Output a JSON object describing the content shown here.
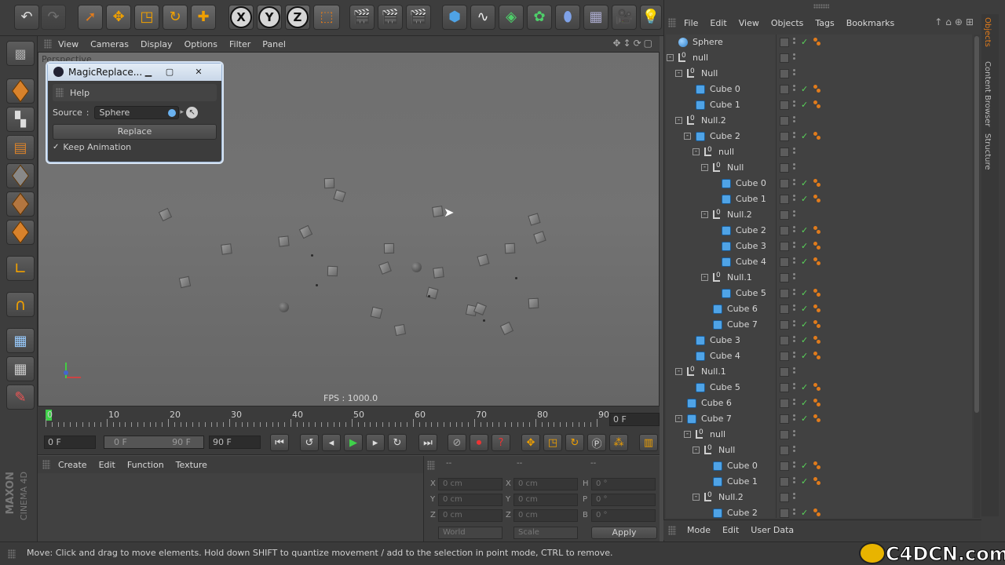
{
  "toolbar": {
    "axis_x": "X",
    "axis_y": "Y",
    "axis_z": "Z",
    "icons": [
      "undo-icon",
      "redo-icon",
      "select-icon",
      "move-icon",
      "scale-icon",
      "rotate-icon",
      "add-icon",
      "x-axis",
      "y-axis",
      "z-axis",
      "coord-system-icon",
      "render-view-icon",
      "render-pv-icon",
      "render-settings-icon",
      "cube-primitive-icon",
      "spline-icon",
      "nurbs-icon",
      "array-icon",
      "deformer-icon",
      "floor-icon",
      "camera-icon",
      "light-icon"
    ]
  },
  "viewport": {
    "menu": [
      "View",
      "Cameras",
      "Display",
      "Options",
      "Filter",
      "Panel"
    ],
    "label": "Perspective",
    "fps": "FPS : 1000.0"
  },
  "dialog": {
    "title": "MagicReplace...",
    "help": "Help",
    "source_label": "Source",
    "source_sep": ":",
    "source_value": "Sphere",
    "replace": "Replace",
    "keep_animation": "Keep Animation"
  },
  "timeline": {
    "ticks": [
      "0",
      "10",
      "20",
      "30",
      "40",
      "50",
      "60",
      "70",
      "80",
      "90"
    ],
    "current_frame": "0 F",
    "start": "0 F",
    "range_start": "0 F",
    "range_end": "90 F",
    "end": "90 F"
  },
  "material": {
    "menu": [
      "Create",
      "Edit",
      "Function",
      "Texture"
    ]
  },
  "coords": {
    "header": [
      "--",
      "--",
      "--"
    ],
    "rows": [
      {
        "a": "X",
        "av": "0 cm",
        "b": "X",
        "bv": "0 cm",
        "c": "H",
        "cv": "0 °"
      },
      {
        "a": "Y",
        "av": "0 cm",
        "b": "Y",
        "bv": "0 cm",
        "c": "P",
        "cv": "0 °"
      },
      {
        "a": "Z",
        "av": "0 cm",
        "b": "Z",
        "bv": "0 cm",
        "c": "B",
        "cv": "0 °"
      }
    ],
    "world": "World",
    "scale": "Scale",
    "apply": "Apply"
  },
  "status": "Move: Click and drag to move elements. Hold down SHIFT to quantize movement / add to the selection in point mode, CTRL to remove.",
  "objects": {
    "menu": [
      "File",
      "Edit",
      "View",
      "Objects",
      "Tags",
      "Bookmarks"
    ],
    "items": [
      {
        "name": "Sphere",
        "type": "sphere",
        "depth": 0,
        "check": true,
        "tag": true,
        "exp": ""
      },
      {
        "name": "null",
        "type": "null",
        "depth": 0,
        "check": false,
        "tag": false,
        "exp": "-"
      },
      {
        "name": "Null",
        "type": "null",
        "depth": 1,
        "check": false,
        "tag": false,
        "exp": "-"
      },
      {
        "name": "Cube 0",
        "type": "cube",
        "depth": 2,
        "check": true,
        "tag": true,
        "exp": ""
      },
      {
        "name": "Cube 1",
        "type": "cube",
        "depth": 2,
        "check": true,
        "tag": true,
        "exp": ""
      },
      {
        "name": "Null.2",
        "type": "null",
        "depth": 1,
        "check": false,
        "tag": false,
        "exp": "-"
      },
      {
        "name": "Cube 2",
        "type": "cube",
        "depth": 2,
        "check": true,
        "tag": true,
        "exp": "-"
      },
      {
        "name": "null",
        "type": "null",
        "depth": 3,
        "check": false,
        "tag": false,
        "exp": "-"
      },
      {
        "name": "Null",
        "type": "null",
        "depth": 4,
        "check": false,
        "tag": false,
        "exp": "-"
      },
      {
        "name": "Cube 0",
        "type": "cube",
        "depth": 5,
        "check": true,
        "tag": true,
        "exp": ""
      },
      {
        "name": "Cube 1",
        "type": "cube",
        "depth": 5,
        "check": true,
        "tag": true,
        "exp": ""
      },
      {
        "name": "Null.2",
        "type": "null",
        "depth": 4,
        "check": false,
        "tag": false,
        "exp": "-"
      },
      {
        "name": "Cube 2",
        "type": "cube",
        "depth": 5,
        "check": true,
        "tag": true,
        "exp": ""
      },
      {
        "name": "Cube 3",
        "type": "cube",
        "depth": 5,
        "check": true,
        "tag": true,
        "exp": ""
      },
      {
        "name": "Cube 4",
        "type": "cube",
        "depth": 5,
        "check": true,
        "tag": true,
        "exp": ""
      },
      {
        "name": "Null.1",
        "type": "null",
        "depth": 4,
        "check": false,
        "tag": false,
        "exp": "-"
      },
      {
        "name": "Cube 5",
        "type": "cube",
        "depth": 5,
        "check": true,
        "tag": true,
        "exp": ""
      },
      {
        "name": "Cube 6",
        "type": "cube",
        "depth": 4,
        "check": true,
        "tag": true,
        "exp": ""
      },
      {
        "name": "Cube 7",
        "type": "cube",
        "depth": 4,
        "check": true,
        "tag": true,
        "exp": ""
      },
      {
        "name": "Cube 3",
        "type": "cube",
        "depth": 2,
        "check": true,
        "tag": true,
        "exp": ""
      },
      {
        "name": "Cube 4",
        "type": "cube",
        "depth": 2,
        "check": true,
        "tag": true,
        "exp": ""
      },
      {
        "name": "Null.1",
        "type": "null",
        "depth": 1,
        "check": false,
        "tag": false,
        "exp": "-"
      },
      {
        "name": "Cube 5",
        "type": "cube",
        "depth": 2,
        "check": true,
        "tag": true,
        "exp": ""
      },
      {
        "name": "Cube 6",
        "type": "cube",
        "depth": 1,
        "check": true,
        "tag": true,
        "exp": ""
      },
      {
        "name": "Cube 7",
        "type": "cube",
        "depth": 1,
        "check": true,
        "tag": true,
        "exp": "-"
      },
      {
        "name": "null",
        "type": "null",
        "depth": 2,
        "check": false,
        "tag": false,
        "exp": "-"
      },
      {
        "name": "Null",
        "type": "null",
        "depth": 3,
        "check": false,
        "tag": false,
        "exp": "-"
      },
      {
        "name": "Cube 0",
        "type": "cube",
        "depth": 4,
        "check": true,
        "tag": true,
        "exp": ""
      },
      {
        "name": "Cube 1",
        "type": "cube",
        "depth": 4,
        "check": true,
        "tag": true,
        "exp": ""
      },
      {
        "name": "Null.2",
        "type": "null",
        "depth": 3,
        "check": false,
        "tag": false,
        "exp": "-"
      },
      {
        "name": "Cube 2",
        "type": "cube",
        "depth": 4,
        "check": true,
        "tag": true,
        "exp": ""
      }
    ]
  },
  "side_tabs": [
    "Objects",
    "Content Browser",
    "Structure"
  ],
  "attributes": {
    "menu": [
      "Mode",
      "Edit",
      "User Data"
    ]
  },
  "brand": {
    "maxon": "MAXON",
    "cinema": "CINEMA 4D",
    "watermark": "C4DCN.com"
  },
  "colors": {
    "accent": "#4fa3e6",
    "tag": "#e07b1c",
    "check": "#59d459",
    "dialog_border": "#9ab4d4"
  }
}
